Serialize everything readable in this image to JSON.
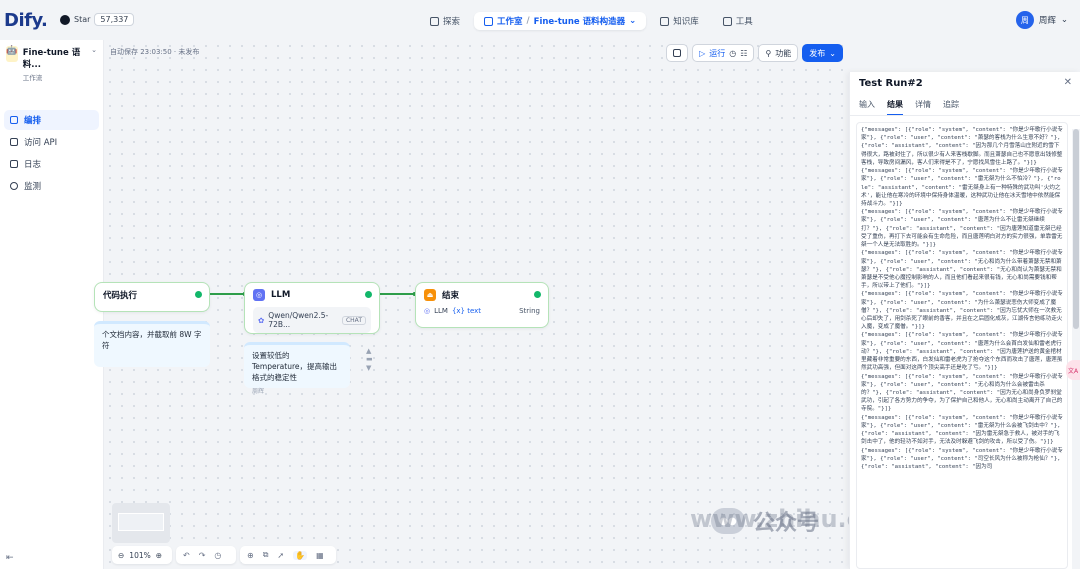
{
  "header": {
    "logo": "Dify.",
    "github_label": "Star",
    "github_count": "57,337",
    "nav": [
      {
        "label": "探索"
      },
      {
        "label": "工作室"
      },
      {
        "label": "Fine-tune 语料构造器"
      },
      {
        "label": "知识库"
      },
      {
        "label": "工具"
      }
    ],
    "user_initial": "周",
    "user_name": "周辉"
  },
  "sidebar": {
    "app_name": "Fine-tune 语料...",
    "app_type": "工作流",
    "items": [
      {
        "label": "编排"
      },
      {
        "label": "访问 API"
      },
      {
        "label": "日志"
      },
      {
        "label": "监测"
      }
    ]
  },
  "canvas": {
    "autosave": "自动保存 23:03:50 · 未发布",
    "toolbar": {
      "run": "运行",
      "features": "功能",
      "publish": "发布"
    },
    "nodes": {
      "code": {
        "title": "代码执行",
        "note": "个文档内容，并截取前 8W 字符"
      },
      "llm": {
        "title": "LLM",
        "model": "Qwen/Qwen2.5-72B...",
        "tag": "CHAT",
        "note": "设置较低的 Temperature，提高输出格式的稳定性",
        "note_author": "周辉"
      },
      "end": {
        "title": "结束",
        "var_prefix": "LLM",
        "var_name": "{x} text",
        "var_type": "String"
      }
    },
    "zoom": "101%"
  },
  "watermark": {
    "label": "公众号",
    "url": "www.zhihu.co"
  },
  "panel": {
    "title": "Test Run#2",
    "tabs": [
      {
        "label": "输入"
      },
      {
        "label": "结果"
      },
      {
        "label": "详情"
      },
      {
        "label": "追踪"
      }
    ],
    "output": "{\"messages\": [{\"role\": \"system\", \"content\": \"你是少年歌行小说专家\"}, {\"role\": \"user\", \"content\": \"萧瑟的客栈为什么生意不好？\"}, {\"role\": \"assistant\", \"content\": \"因为那几个月雪落山庄附近的雪下得很大，路被封住了，所以很少有人来客栈歇脚。而且萧瑟自己也不愿意出钱修整客栈，导致房间漏风，客人们来得是不了，宁愿找风雪住上路了。\"}]}\n{\"messages\": [{\"role\": \"system\", \"content\": \"你是少年歌行小说专家\"}, {\"role\": \"user\", \"content\": \"雷无桀为什么不怕冷？\"}, {\"role\": \"assistant\", \"content\": \"雷无桀身上有一种特殊的武功叫'火灼之术'，能让他在寒冷的环境中保持身体温暖，这种武功让他在冰天雪地中依然能保持战斗力。\"}]}\n{\"messages\": [{\"role\": \"system\", \"content\": \"你是少年歌行小说专家\"}, {\"role\": \"user\", \"content\": \"唐莲为什么不让雷无桀继续打？\"}, {\"role\": \"assistant\", \"content\": \"因为唐莲知道雷无桀已经受了重伤，再打下去可能会有生命危险，而且唐莲明白对方的实力很强，单靠雷无桀一个人是无法取胜的。\"}]}\n{\"messages\": [{\"role\": \"system\", \"content\": \"你是少年歌行小说专家\"}, {\"role\": \"user\", \"content\": \"无心和尚为什么带着萧瑟无禁和萧瑟？\"}, {\"role\": \"assistant\", \"content\": \"无心和尚认为萧瑟无禁和萧瑟是不受他心魔控制影响的人，而且他们看起来很有钱，无心和尚需要钱和帮手，所以带上了他们。\"}]}\n{\"messages\": [{\"role\": \"system\", \"content\": \"你是少年歌行小说专家\"}, {\"role\": \"user\", \"content\": \"为什么萧瑟说悲伤大师变成了魔僧？\"}, {\"role\": \"assistant\", \"content\": \"因为忘忧大师在一次救无心后却失了，用剑杀死了眼前的香客，并且在之后圆化成灰，江湖传言他练功走火入魔，变成了魔僧。\"}]}\n{\"messages\": [{\"role\": \"system\", \"content\": \"你是少年歌行小说专家\"}, {\"role\": \"user\", \"content\": \"唐莲为什么会首白发仙和雷老虎行动？\"}, {\"role\": \"assistant\", \"content\": \"因为唐莲护送的黄金棺材里藏着非常重要的东西，白发仙和雷老虎为了抢夺这个东西而攻击了唐莲，唐莲虽然武功高强，但面对这两个顶尖高手还是吃了亏。\"}]}\n{\"messages\": [{\"role\": \"system\", \"content\": \"你是少年歌行小说专家\"}, {\"role\": \"user\", \"content\": \"无心和尚为什么会被雷击杀的？\"}, {\"role\": \"assistant\", \"content\": \"因为无心和尚身负罗刹堂武功，引起了各方势力的争夺，为了保护自己和他人，无心和尚主动离开了自己的寺院。\"}]}\n{\"messages\": [{\"role\": \"system\", \"content\": \"你是少年歌行小说专家\"}, {\"role\": \"user\", \"content\": \"雷无桀为什么会被飞剑击中？\"}, {\"role\": \"assistant\", \"content\": \"因为雷无桀急于救人，被对手的飞剑击中了，他的轻功不如对手，无法及时躲避飞剑的攻击，所以受了伤。\"}]}\n{\"messages\": [{\"role\": \"system\", \"content\": \"你是少年歌行小说专家\"}, {\"role\": \"user\", \"content\": \"司空长风为什么被称为枪仙？\"}, {\"role\": \"assistant\", \"content\": \"因为司"
  }
}
